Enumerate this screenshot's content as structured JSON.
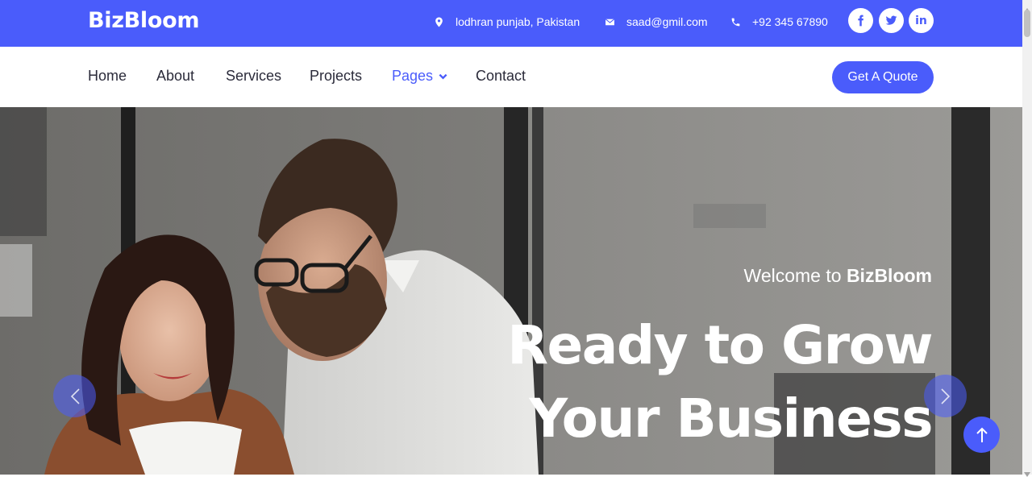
{
  "brand": {
    "name": "BizBloom",
    "color": "#4a5cfb"
  },
  "topbar": {
    "location": "lodhran punjab, Pakistan",
    "email": "saad@gmil.com",
    "phone": "+92 345 67890",
    "social": [
      {
        "icon": "facebook-icon",
        "glyph": "f"
      },
      {
        "icon": "twitter-icon"
      },
      {
        "icon": "linkedin-icon",
        "glyph": "in"
      }
    ]
  },
  "nav": {
    "items": [
      {
        "label": "Home"
      },
      {
        "label": "About"
      },
      {
        "label": "Services"
      },
      {
        "label": "Projects"
      },
      {
        "label": "Pages",
        "active": true,
        "has_dropdown": true
      },
      {
        "label": "Contact"
      }
    ],
    "cta_label": "Get A Quote"
  },
  "hero": {
    "welcome_prefix": "Welcome to",
    "welcome_brand": "BizBloom",
    "headline_line1": "Ready to Grow",
    "headline_line2": "Your Business",
    "prev_icon": "chevron-left-icon",
    "next_icon": "chevron-right-icon"
  },
  "back_to_top_icon": "arrow-up-icon"
}
